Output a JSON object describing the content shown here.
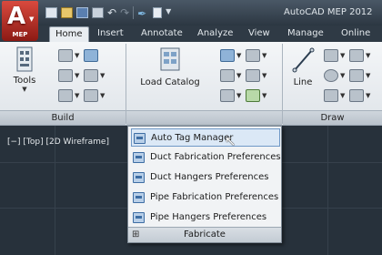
{
  "app": {
    "title": "AutoCAD MEP 2012",
    "app_button_badge": "MEP"
  },
  "tabs": [
    {
      "label": "Home",
      "active": true
    },
    {
      "label": "Insert"
    },
    {
      "label": "Annotate"
    },
    {
      "label": "Analyze"
    },
    {
      "label": "View"
    },
    {
      "label": "Manage"
    },
    {
      "label": "Online"
    }
  ],
  "ribbon": {
    "tools_label": "Tools",
    "build_panel_title": "Build",
    "load_catalog_label": "Load Catalog",
    "line_label": "Line",
    "draw_panel_title": "Draw"
  },
  "viewport": {
    "label": "[−] [Top] [2D Wireframe]"
  },
  "fabricate_menu": {
    "items": [
      {
        "label": "Auto Tag Manager",
        "icon": "tag-manager-icon",
        "hover": true
      },
      {
        "label": "Duct Fabrication Preferences",
        "icon": "duct-fabrication-icon"
      },
      {
        "label": "Duct Hangers Preferences",
        "icon": "duct-hangers-icon"
      },
      {
        "label": "Pipe Fabrication Preferences",
        "icon": "pipe-fabrication-icon"
      },
      {
        "label": "Pipe Hangers Preferences",
        "icon": "pipe-hangers-icon"
      }
    ],
    "footer_label": "Fabricate"
  },
  "colors": {
    "app_button": "#c0392b",
    "drawing_background": "#27313b",
    "menu_hover": "#dbe8f6"
  }
}
